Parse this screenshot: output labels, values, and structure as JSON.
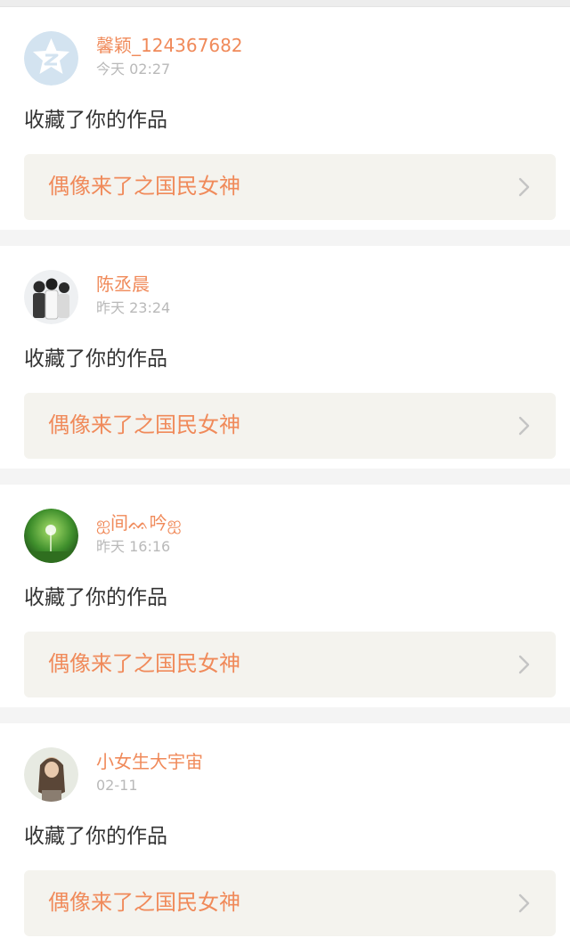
{
  "colors": {
    "accent": "#f08a5a",
    "time_gray": "#b9b9b9",
    "text_dark": "#333333",
    "card_bg": "#ffffff",
    "work_bg": "#f4f3ee",
    "page_bg": "#f4f4f4"
  },
  "notifications": [
    {
      "avatar_icon": "default-star-avatar-icon",
      "username": "馨颖_124367682",
      "time": "今天  02:27",
      "action": "收藏了你的作品",
      "work_title": "偶像来了之国民女神"
    },
    {
      "avatar_icon": "group-photo-avatar-icon",
      "username": "陈丞晨",
      "time": "昨天  23:24",
      "action": "收藏了你的作品",
      "work_title": "偶像来了之国民女神"
    },
    {
      "avatar_icon": "dandelion-photo-avatar-icon",
      "username": "ஐ间ᨐ吟ஐ",
      "time": "昨天  16:16",
      "action": "收藏了你的作品",
      "work_title": "偶像来了之国民女神"
    },
    {
      "avatar_icon": "girl-photo-avatar-icon",
      "username": "小女生大宇宙",
      "time": "02-11",
      "action": "收藏了你的作品",
      "work_title": "偶像来了之国民女神"
    }
  ]
}
